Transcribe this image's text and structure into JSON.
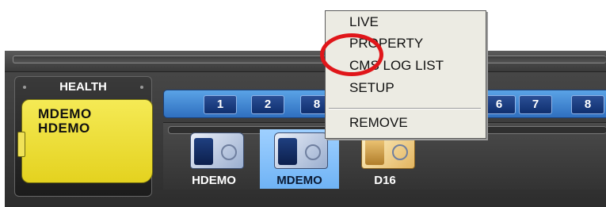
{
  "health": {
    "title": "HEALTH",
    "card_lines": [
      "MDEMO",
      "HDEMO"
    ]
  },
  "channels": [
    "1",
    "2",
    "8",
    "6",
    "7",
    "8"
  ],
  "devices": [
    {
      "label": "HDEMO",
      "selected": false
    },
    {
      "label": "MDEMO",
      "selected": true
    },
    {
      "label": "D16",
      "selected": false
    }
  ],
  "context_menu": {
    "items": [
      "LIVE",
      "PROPERTY",
      "CMS LOG LIST",
      "SETUP",
      "REMOVE"
    ]
  },
  "colors": {
    "highlight_ring": "#e0161a",
    "card_yellow": "#f0e040",
    "channel_bar_blue": "#3f86d4",
    "selection_blue": "#8cc4fb"
  }
}
